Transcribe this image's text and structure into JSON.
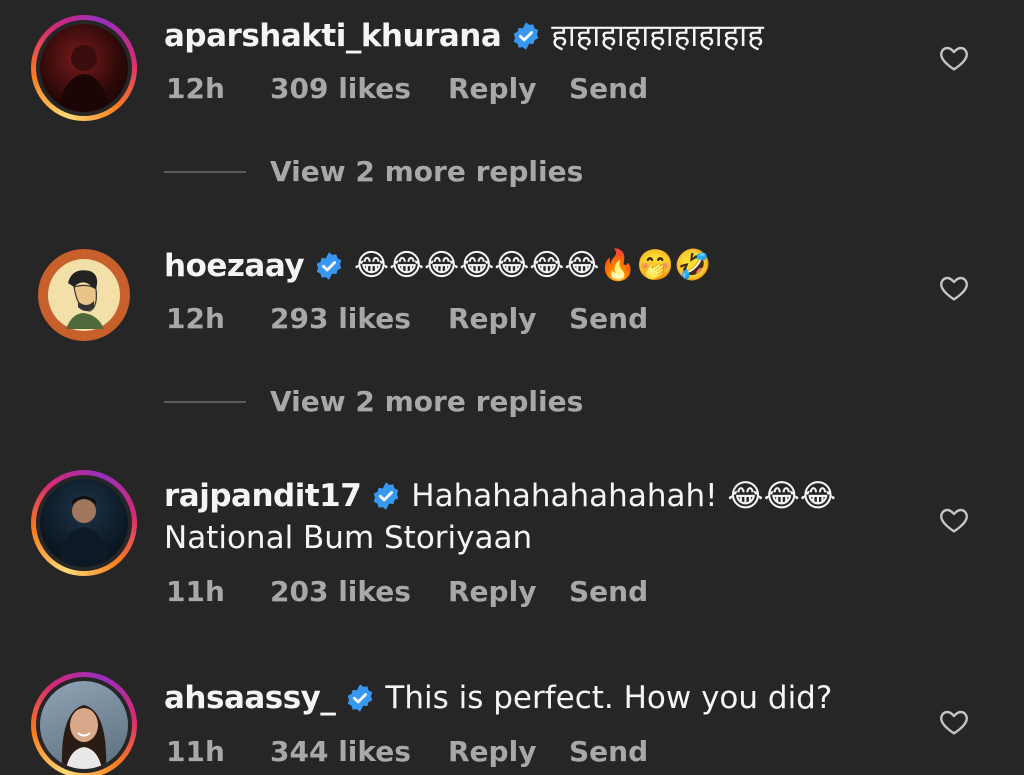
{
  "comments": [
    {
      "username": "aparshakti_khurana",
      "text": "हाहाहाहाहाहाहाहाह",
      "time": "12h",
      "likes": "309 likes",
      "reply": "Reply",
      "send": "Send",
      "view_more": "View 2 more replies"
    },
    {
      "username": "hoezaay",
      "text": "😂😂😂😂😂😂😂🔥🤭🤣",
      "time": "12h",
      "likes": "293 likes",
      "reply": "Reply",
      "send": "Send",
      "view_more": "View 2 more replies"
    },
    {
      "username": "rajpandit17",
      "text": "Hahahahahahahah! 😂😂😂",
      "text_line2": "National Bum Storiyaan",
      "time": "11h",
      "likes": "203 likes",
      "reply": "Reply",
      "send": "Send"
    },
    {
      "username": "ahsaassy_",
      "text": "This is perfect. How you did?",
      "time": "11h",
      "likes": "344 likes",
      "reply": "Reply",
      "send": "Send"
    }
  ],
  "icons": {
    "verified": "verified-badge-icon",
    "like": "heart-outline-icon"
  },
  "colors": {
    "background": "#262626",
    "text": "#f5f5f5",
    "secondary_text": "#a8a8a8",
    "verified_blue": "#3897f0"
  }
}
